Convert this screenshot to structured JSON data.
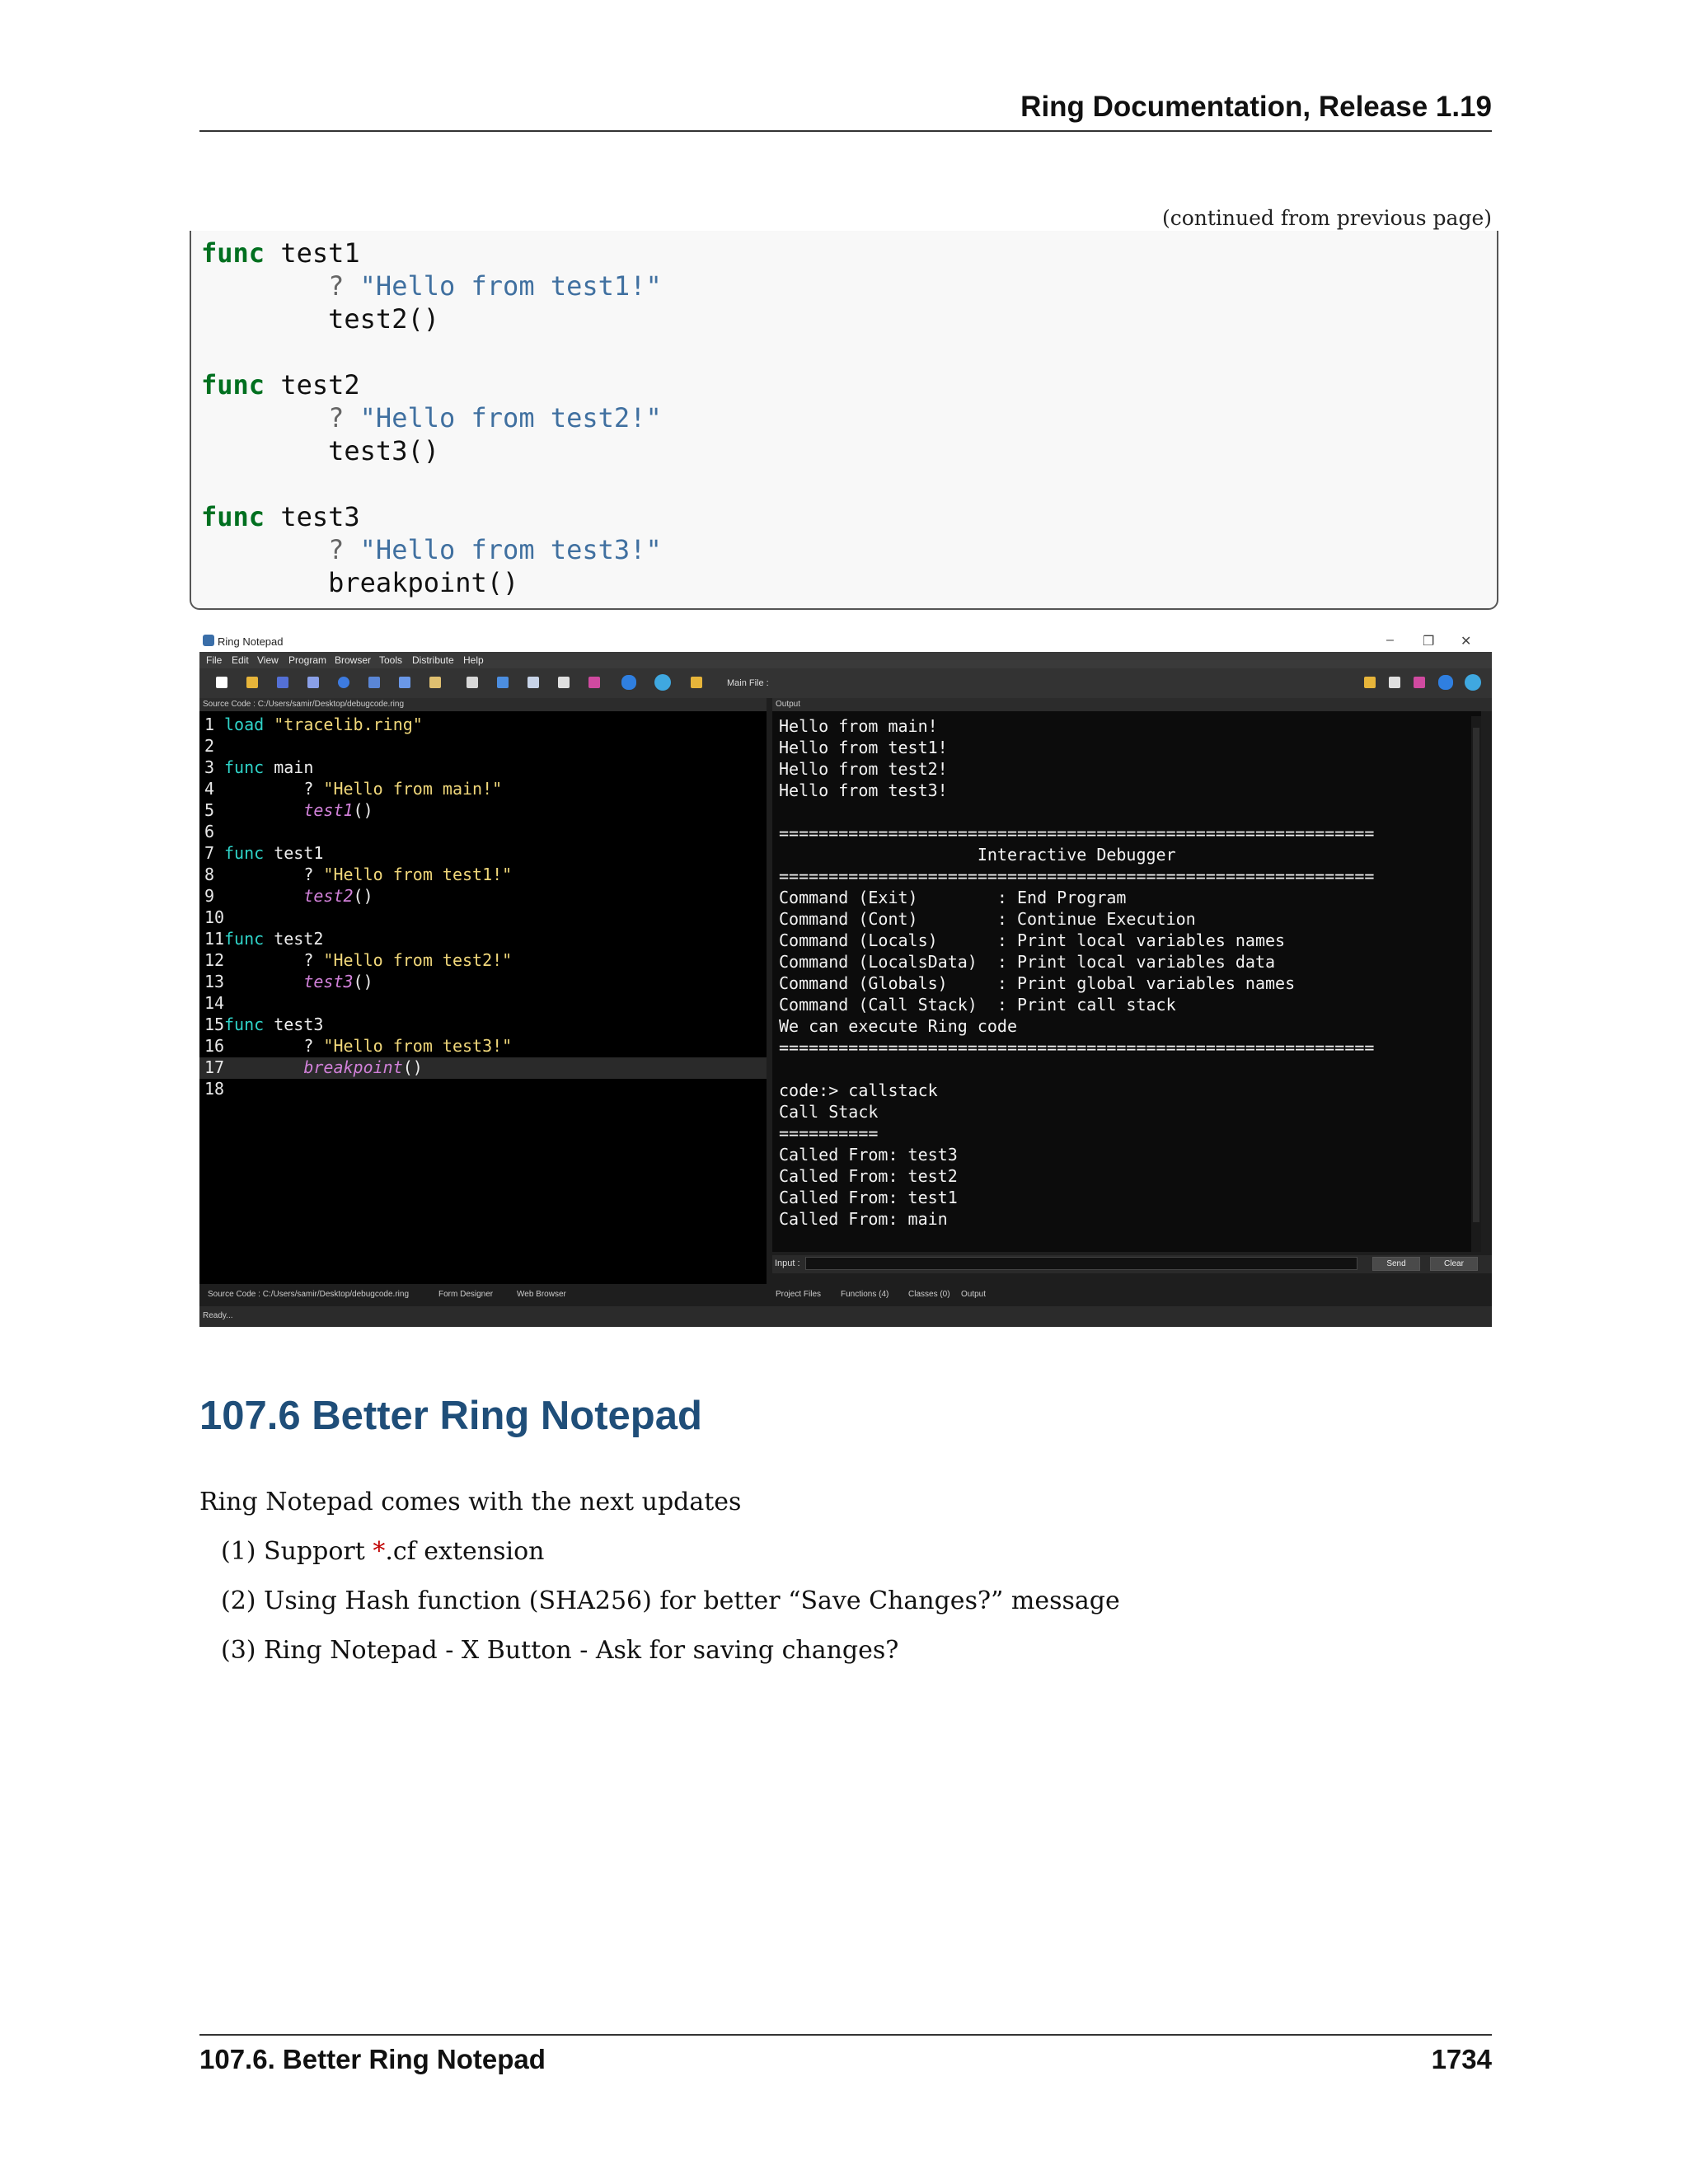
{
  "header": {
    "title": "Ring Documentation, Release 1.19",
    "continued": "(continued from previous page)"
  },
  "code": [
    [
      {
        "t": "func",
        "c": "kw"
      },
      {
        "t": " test1",
        "c": ""
      }
    ],
    [
      {
        "t": "        ",
        "c": ""
      },
      {
        "t": "?",
        "c": "op"
      },
      {
        "t": " ",
        "c": ""
      },
      {
        "t": "\"Hello from test1!\"",
        "c": "str"
      }
    ],
    [
      {
        "t": "        test2()",
        "c": ""
      }
    ],
    [
      {
        "t": "",
        "c": ""
      }
    ],
    [
      {
        "t": "func",
        "c": "kw"
      },
      {
        "t": " test2",
        "c": ""
      }
    ],
    [
      {
        "t": "        ",
        "c": ""
      },
      {
        "t": "?",
        "c": "op"
      },
      {
        "t": " ",
        "c": ""
      },
      {
        "t": "\"Hello from test2!\"",
        "c": "str"
      }
    ],
    [
      {
        "t": "        test3()",
        "c": ""
      }
    ],
    [
      {
        "t": "",
        "c": ""
      }
    ],
    [
      {
        "t": "func",
        "c": "kw"
      },
      {
        "t": " test3",
        "c": ""
      }
    ],
    [
      {
        "t": "        ",
        "c": ""
      },
      {
        "t": "?",
        "c": "op"
      },
      {
        "t": " ",
        "c": ""
      },
      {
        "t": "\"Hello from test3!\"",
        "c": "str"
      }
    ],
    [
      {
        "t": "        breakpoint()",
        "c": ""
      }
    ]
  ],
  "notepad": {
    "window_title": "Ring Notepad",
    "menu": [
      "File",
      "Edit",
      "View",
      "Program",
      "Browser",
      "Tools",
      "Distribute",
      "Help"
    ],
    "main_file_label": "Main File :",
    "source_panel_title": "Source Code : C:/Users/samir/Desktop/debugcode.ring",
    "output_panel_title": "Output",
    "editor_lines": [
      {
        "n": "1",
        "parts": [
          {
            "t": "load",
            "c": "e-kw"
          },
          {
            "t": " ",
            "c": ""
          },
          {
            "t": "\"tracelib.ring\"",
            "c": "e-str"
          }
        ]
      },
      {
        "n": "2",
        "parts": []
      },
      {
        "n": "3",
        "parts": [
          {
            "t": "func",
            "c": "e-kw"
          },
          {
            "t": " main",
            "c": ""
          }
        ]
      },
      {
        "n": "4",
        "parts": [
          {
            "t": "        ? ",
            "c": ""
          },
          {
            "t": "\"Hello from main!\"",
            "c": "e-str"
          }
        ]
      },
      {
        "n": "5",
        "parts": [
          {
            "t": "        ",
            "c": ""
          },
          {
            "t": "test1",
            "c": "e-fn"
          },
          {
            "t": "()",
            "c": ""
          }
        ]
      },
      {
        "n": "6",
        "parts": []
      },
      {
        "n": "7",
        "parts": [
          {
            "t": "func",
            "c": "e-kw"
          },
          {
            "t": " test1",
            "c": ""
          }
        ]
      },
      {
        "n": "8",
        "parts": [
          {
            "t": "        ? ",
            "c": ""
          },
          {
            "t": "\"Hello from test1!\"",
            "c": "e-str"
          }
        ]
      },
      {
        "n": "9",
        "parts": [
          {
            "t": "        ",
            "c": ""
          },
          {
            "t": "test2",
            "c": "e-fn"
          },
          {
            "t": "()",
            "c": ""
          }
        ]
      },
      {
        "n": "10",
        "parts": []
      },
      {
        "n": "11",
        "parts": [
          {
            "t": "func",
            "c": "e-kw"
          },
          {
            "t": " test2",
            "c": ""
          }
        ]
      },
      {
        "n": "12",
        "parts": [
          {
            "t": "        ? ",
            "c": ""
          },
          {
            "t": "\"Hello from test2!\"",
            "c": "e-str"
          }
        ]
      },
      {
        "n": "13",
        "parts": [
          {
            "t": "        ",
            "c": ""
          },
          {
            "t": "test3",
            "c": "e-fn"
          },
          {
            "t": "()",
            "c": ""
          }
        ]
      },
      {
        "n": "14",
        "parts": []
      },
      {
        "n": "15",
        "parts": [
          {
            "t": "func",
            "c": "e-kw"
          },
          {
            "t": " test3",
            "c": ""
          }
        ]
      },
      {
        "n": "16",
        "parts": [
          {
            "t": "        ? ",
            "c": ""
          },
          {
            "t": "\"Hello from test3!\"",
            "c": "e-str"
          }
        ]
      },
      {
        "n": "17",
        "parts": [
          {
            "t": "        ",
            "c": ""
          },
          {
            "t": "breakpoint",
            "c": "e-fn"
          },
          {
            "t": "()",
            "c": ""
          }
        ],
        "current": true
      },
      {
        "n": "18",
        "parts": []
      }
    ],
    "output_lines": [
      "Hello from main!",
      "Hello from test1!",
      "Hello from test2!",
      "Hello from test3!",
      "",
      "============================================================",
      "                    Interactive Debugger",
      "============================================================",
      "Command (Exit)        : End Program",
      "Command (Cont)        : Continue Execution",
      "Command (Locals)      : Print local variables names",
      "Command (LocalsData)  : Print local variables data",
      "Command (Globals)     : Print global variables names",
      "Command (Call Stack)  : Print call stack",
      "We can execute Ring code",
      "============================================================",
      "",
      "code:> callstack",
      "Call Stack",
      "==========",
      "Called From: test3",
      "Called From: test2",
      "Called From: test1",
      "Called From: main"
    ],
    "input_label": "Input :",
    "send_label": "Send",
    "clear_label": "Clear",
    "left_tabs": [
      "Source Code : C:/Users/samir/Desktop/debugcode.ring",
      "Form Designer",
      "Web Browser"
    ],
    "right_tabs": [
      "Project Files",
      "Functions (4)",
      "Classes (0)",
      "Output"
    ],
    "status": "Ready..."
  },
  "section": {
    "heading": "107.6  Better Ring Notepad",
    "intro": "Ring Notepad comes with the next updates",
    "items": [
      {
        "num": "(1)",
        "pre": "Support ",
        "star": "*",
        "post": ".cf extension"
      },
      {
        "num": "(2)",
        "pre": "Using Hash function (SHA256) for better “Save Changes?” message",
        "star": "",
        "post": ""
      },
      {
        "num": "(3)",
        "pre": "Ring Notepad - X Button - Ask for saving changes?",
        "star": "",
        "post": ""
      }
    ]
  },
  "footer": {
    "section": "107.6.  Better Ring Notepad",
    "page": "1734"
  },
  "colors": {
    "heading": "#1f4e79",
    "keyword": "#007020",
    "string": "#4070a0",
    "star": "#c00000"
  }
}
